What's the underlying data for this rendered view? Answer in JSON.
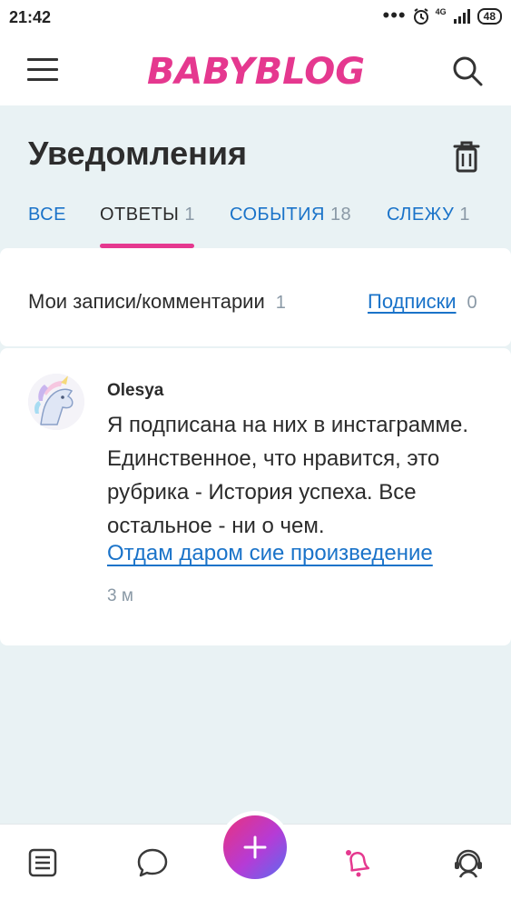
{
  "status_bar": {
    "time": "21:42",
    "network": "4G",
    "battery": "48"
  },
  "header": {
    "logo_text": "BABYBLOG",
    "brand_color": "#e5388f"
  },
  "page": {
    "title": "Уведомления"
  },
  "tabs": [
    {
      "label": "ВСЕ",
      "count": ""
    },
    {
      "label": "ОТВЕТЫ",
      "count": "1",
      "active": true
    },
    {
      "label": "СОБЫТИЯ",
      "count": "18"
    },
    {
      "label": "СЛЕЖУ",
      "count": "1"
    }
  ],
  "filters": {
    "my_posts": {
      "label": "Мои записи/комментарии",
      "count": "1"
    },
    "subscriptions": {
      "label": "Подписки",
      "count": "0"
    }
  },
  "notification": {
    "author": "Olesya",
    "message": "Я подписана на них в инстаграмме. Единственное, что нравится, это рубрика - История успеха. Все остальное - ни о чем.",
    "link_text": "Отдам даром сие произведение",
    "time": "3 м"
  },
  "bottom_nav": {
    "items": [
      "feed-icon",
      "chat-icon",
      "add-icon",
      "bell-icon",
      "support-icon"
    ]
  }
}
